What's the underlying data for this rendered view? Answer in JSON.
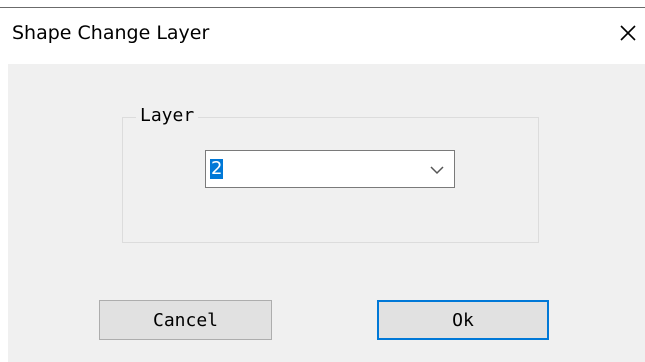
{
  "dialog": {
    "title": "Shape Change Layer"
  },
  "layer_group": {
    "label": "Layer",
    "combo_value": "2"
  },
  "buttons": {
    "cancel_label": "Cancel",
    "ok_label": "Ok"
  },
  "colors": {
    "selection": "#0078d7",
    "client_bg": "#f0f0f0",
    "button_bg": "#e1e1e1"
  },
  "icons": {
    "close": "close-icon",
    "dropdown": "chevron-down-icon"
  }
}
